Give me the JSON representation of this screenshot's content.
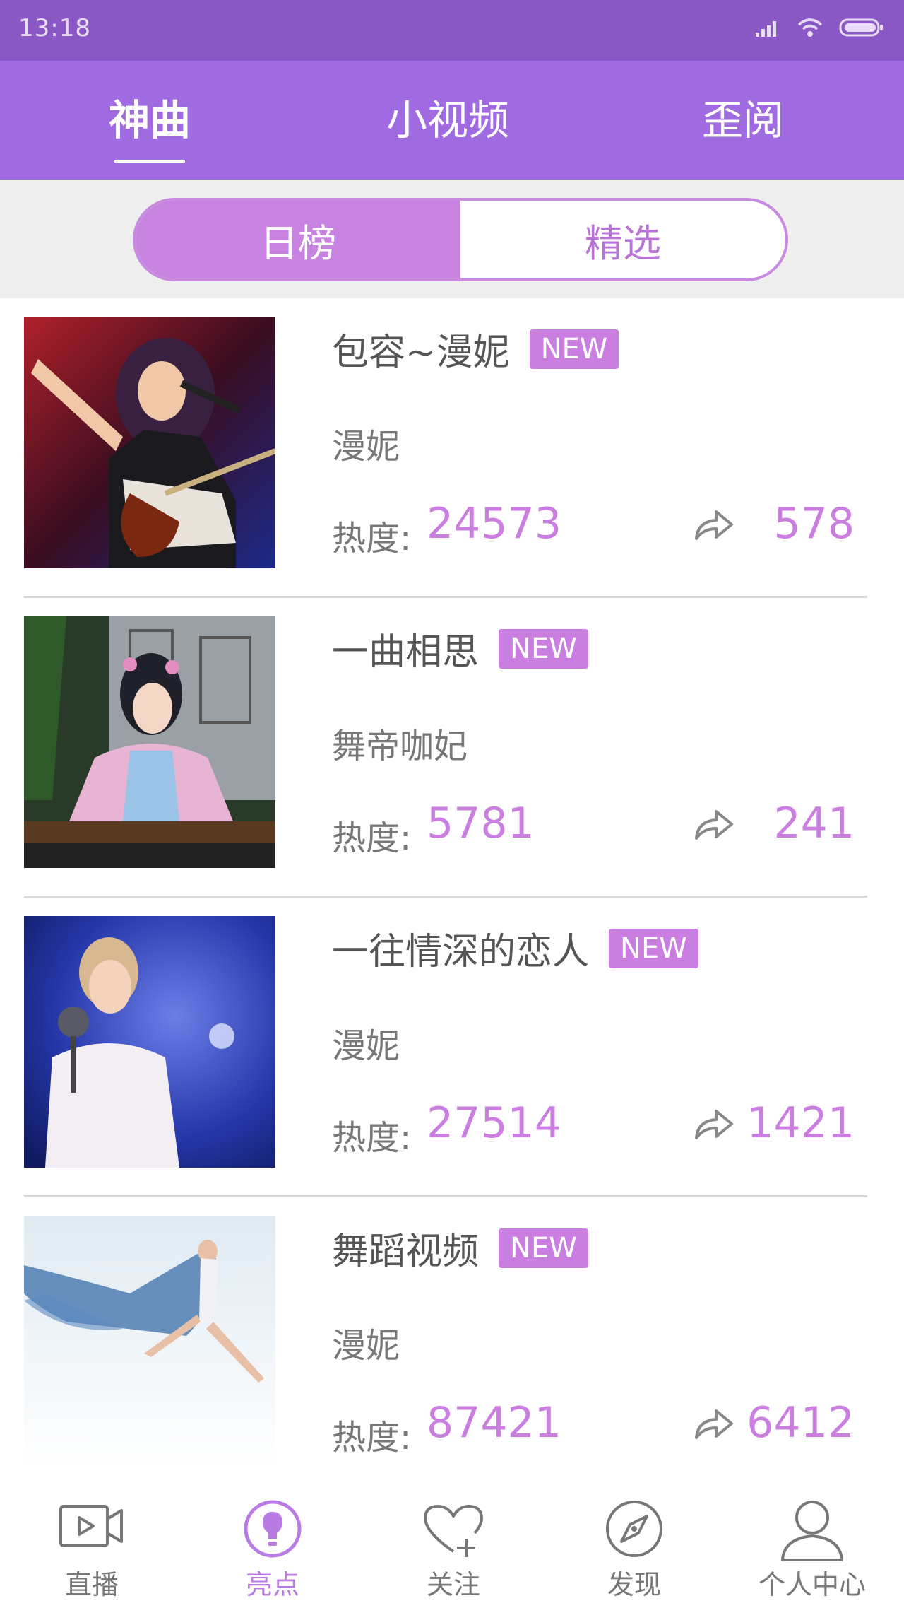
{
  "status_bar": {
    "time": "13:18"
  },
  "top_tabs": [
    {
      "label": "神曲",
      "active": true
    },
    {
      "label": "小视频",
      "active": false
    },
    {
      "label": "歪阅",
      "active": false
    }
  ],
  "segment": [
    {
      "label": "日榜",
      "active": true
    },
    {
      "label": "精选",
      "active": false
    }
  ],
  "list": {
    "heat_label": "热度:",
    "badge": "NEW",
    "items": [
      {
        "title": "包容~漫妮",
        "artist": "漫妮",
        "heat": "24573",
        "shares": "578",
        "thumb_icon": "singer-guitar-photo"
      },
      {
        "title": "一曲相思",
        "artist": "舞帝咖妃",
        "heat": "5781",
        "shares": "241",
        "thumb_icon": "guzheng-player-photo"
      },
      {
        "title": "一往情深的恋人",
        "artist": "漫妮",
        "heat": "27514",
        "shares": "1421",
        "thumb_icon": "singer-microphone-photo"
      },
      {
        "title": "舞蹈视频",
        "artist": "漫妮",
        "heat": "87421",
        "shares": "6412",
        "thumb_icon": "dancer-scarf-photo"
      }
    ]
  },
  "bottom_nav": [
    {
      "label": "直播",
      "icon": "video-camera-icon",
      "active": false
    },
    {
      "label": "亮点",
      "icon": "lightbulb-icon",
      "active": true
    },
    {
      "label": "关注",
      "icon": "heart-plus-icon",
      "active": false
    },
    {
      "label": "发现",
      "icon": "compass-icon",
      "active": false
    },
    {
      "label": "个人中心",
      "icon": "person-icon",
      "active": false
    }
  ],
  "colors": {
    "status_bar": "#8a58c4",
    "nav": "#a06ae0",
    "accent": "#c97ee0",
    "active_nav": "#b77be3"
  }
}
